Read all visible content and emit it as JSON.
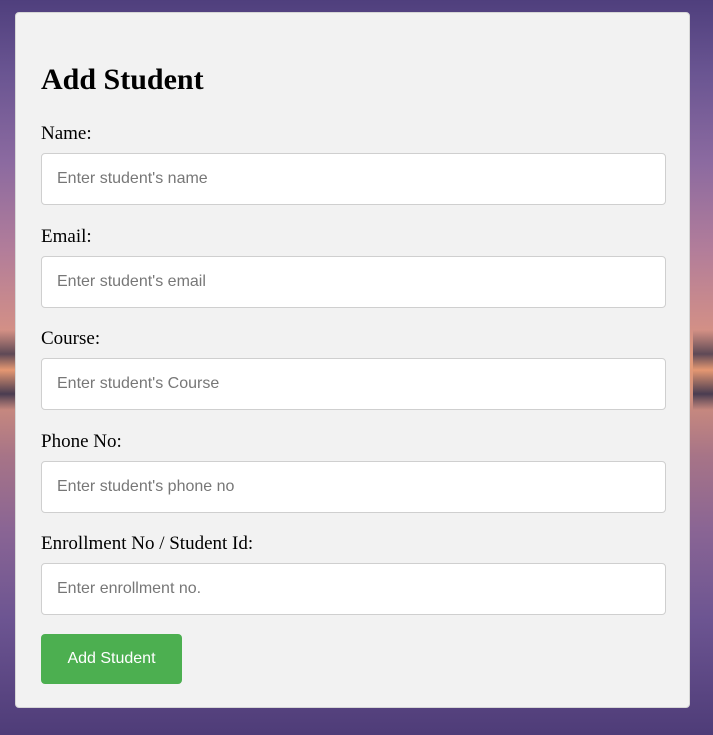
{
  "form": {
    "title": "Add Student",
    "fields": [
      {
        "label": "Name:",
        "placeholder": "Enter student's name",
        "value": ""
      },
      {
        "label": "Email:",
        "placeholder": "Enter student's email",
        "value": ""
      },
      {
        "label": "Course:",
        "placeholder": "Enter student's Course",
        "value": ""
      },
      {
        "label": "Phone No:",
        "placeholder": "Enter student's phone no",
        "value": ""
      },
      {
        "label": "Enrollment No / Student Id:",
        "placeholder": "Enter enrollment no.",
        "value": ""
      }
    ],
    "submit_label": "Add Student"
  },
  "colors": {
    "card_background": "#f2f2f2",
    "button_accent": "#4caf50",
    "button_text": "#ffffff"
  }
}
